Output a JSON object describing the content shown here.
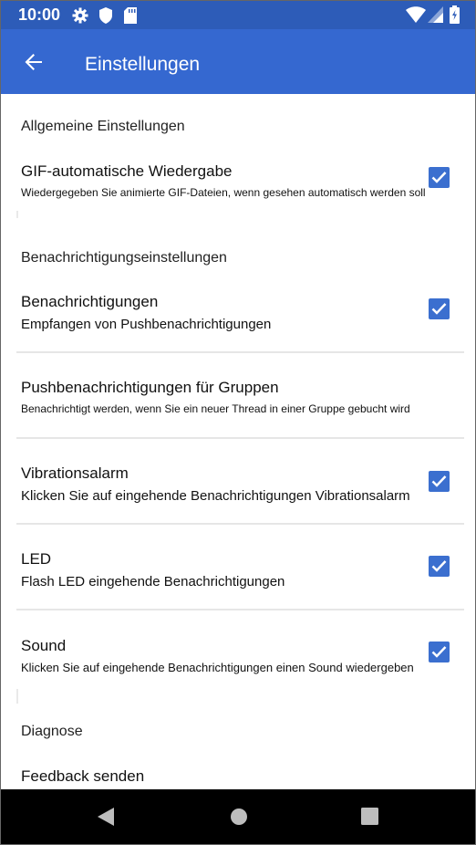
{
  "status_bar": {
    "time": "10:00",
    "icons": [
      "gear-icon",
      "shield-icon",
      "sd-card-icon",
      "wifi-icon",
      "signal-icon",
      "battery-icon"
    ]
  },
  "app_bar": {
    "title": "Einstellungen",
    "back_icon": "arrow-left-icon"
  },
  "colors": {
    "status_bar": "#2d5cb8",
    "app_bar": "#3568d0",
    "checkbox": "#3b6fcf",
    "nav_bar": "#000000"
  },
  "sections": {
    "general": {
      "header": "Allgemeine Einstellungen",
      "gif": {
        "title": "GIF-automatische Wiedergabe",
        "subtitle": "Wiedergegeben Sie animierte GIF-Dateien, wenn gesehen automatisch werden soll",
        "checked": true
      }
    },
    "notifications": {
      "header": "Benachrichtigungseinstellungen",
      "notifications": {
        "title": "Benachrichtigungen",
        "subtitle": "Empfangen von Pushbenachrichtigungen",
        "checked": true
      },
      "group_push": {
        "title": "Pushbenachrichtigungen für Gruppen",
        "subtitle": "Benachrichtigt werden, wenn Sie ein neuer Thread in einer Gruppe gebucht wird"
      },
      "vibration": {
        "title": "Vibrationsalarm",
        "subtitle": "Klicken Sie auf eingehende Benachrichtigungen Vibrationsalarm",
        "checked": true
      },
      "led": {
        "title": "LED",
        "subtitle": "Flash LED eingehende Benachrichtigungen",
        "checked": true
      },
      "sound": {
        "title": "Sound",
        "subtitle": "Klicken Sie auf eingehende Benachrichtigungen einen Sound wiedergeben",
        "checked": true
      }
    },
    "diagnostics": {
      "header": "Diagnose",
      "feedback": {
        "title": "Feedback senden"
      }
    }
  },
  "nav_bar": {
    "icons": [
      "back-triangle-icon",
      "home-circle-icon",
      "recents-square-icon"
    ]
  }
}
